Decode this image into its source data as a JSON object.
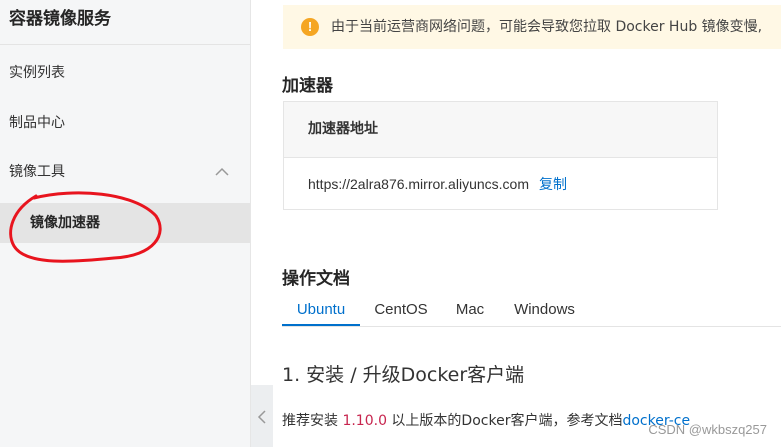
{
  "sidebar": {
    "title": "容器镜像服务",
    "items": [
      {
        "label": "实例列表"
      },
      {
        "label": "制品中心"
      },
      {
        "label": "镜像工具"
      },
      {
        "label": "镜像加速器"
      }
    ]
  },
  "notice": {
    "icon": "warning-icon",
    "text": "由于当前运营商网络问题，可能会导致您拉取 Docker Hub 镜像变慢,"
  },
  "accelerator": {
    "section_title": "加速器",
    "header": "加速器地址",
    "url": "https://2alra876.mirror.aliyuncs.com",
    "copy_label": "复制"
  },
  "docs": {
    "section_title": "操作文档",
    "tabs": [
      "Ubuntu",
      "CentOS",
      "Mac",
      "Windows"
    ],
    "active_tab": "Ubuntu",
    "step_title": "1. 安装 / 升级Docker客户端",
    "desc_prefix": "推荐安装 ",
    "desc_version": "1.10.0",
    "desc_middle": " 以上版本的Docker客户端，参考文档",
    "desc_link": "docker-ce"
  },
  "watermark": "CSDN @wkbszq257",
  "colors": {
    "accent": "#0070cc",
    "warning": "#f5a623",
    "annotation": "#e8141e"
  }
}
